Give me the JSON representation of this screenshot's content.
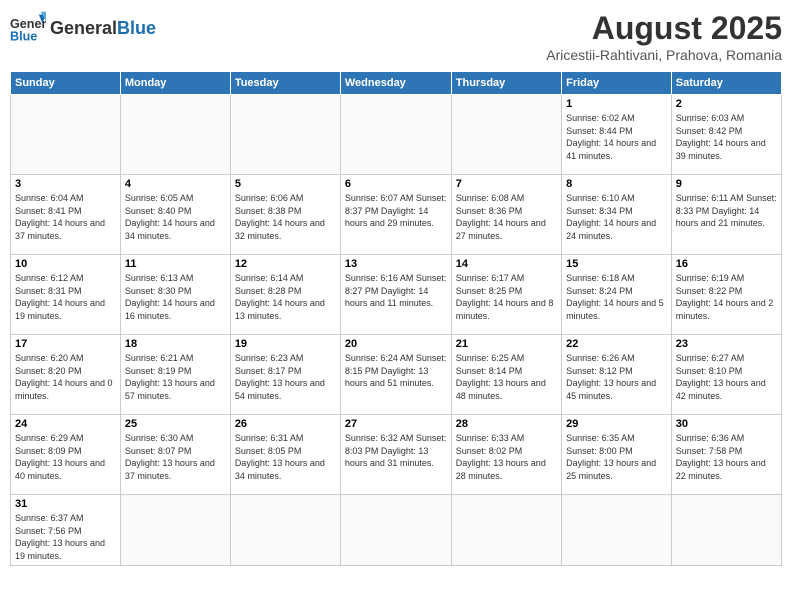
{
  "header": {
    "logo_general": "General",
    "logo_blue": "Blue",
    "month": "August 2025",
    "location": "Aricestii-Rahtivani, Prahova, Romania"
  },
  "days_of_week": [
    "Sunday",
    "Monday",
    "Tuesday",
    "Wednesday",
    "Thursday",
    "Friday",
    "Saturday"
  ],
  "weeks": [
    [
      {
        "day": "",
        "info": ""
      },
      {
        "day": "",
        "info": ""
      },
      {
        "day": "",
        "info": ""
      },
      {
        "day": "",
        "info": ""
      },
      {
        "day": "",
        "info": ""
      },
      {
        "day": "1",
        "info": "Sunrise: 6:02 AM\nSunset: 8:44 PM\nDaylight: 14 hours and 41 minutes."
      },
      {
        "day": "2",
        "info": "Sunrise: 6:03 AM\nSunset: 8:42 PM\nDaylight: 14 hours and 39 minutes."
      }
    ],
    [
      {
        "day": "3",
        "info": "Sunrise: 6:04 AM\nSunset: 8:41 PM\nDaylight: 14 hours and 37 minutes."
      },
      {
        "day": "4",
        "info": "Sunrise: 6:05 AM\nSunset: 8:40 PM\nDaylight: 14 hours and 34 minutes."
      },
      {
        "day": "5",
        "info": "Sunrise: 6:06 AM\nSunset: 8:38 PM\nDaylight: 14 hours and 32 minutes."
      },
      {
        "day": "6",
        "info": "Sunrise: 6:07 AM\nSunset: 8:37 PM\nDaylight: 14 hours and 29 minutes."
      },
      {
        "day": "7",
        "info": "Sunrise: 6:08 AM\nSunset: 8:36 PM\nDaylight: 14 hours and 27 minutes."
      },
      {
        "day": "8",
        "info": "Sunrise: 6:10 AM\nSunset: 8:34 PM\nDaylight: 14 hours and 24 minutes."
      },
      {
        "day": "9",
        "info": "Sunrise: 6:11 AM\nSunset: 8:33 PM\nDaylight: 14 hours and 21 minutes."
      }
    ],
    [
      {
        "day": "10",
        "info": "Sunrise: 6:12 AM\nSunset: 8:31 PM\nDaylight: 14 hours and 19 minutes."
      },
      {
        "day": "11",
        "info": "Sunrise: 6:13 AM\nSunset: 8:30 PM\nDaylight: 14 hours and 16 minutes."
      },
      {
        "day": "12",
        "info": "Sunrise: 6:14 AM\nSunset: 8:28 PM\nDaylight: 14 hours and 13 minutes."
      },
      {
        "day": "13",
        "info": "Sunrise: 6:16 AM\nSunset: 8:27 PM\nDaylight: 14 hours and 11 minutes."
      },
      {
        "day": "14",
        "info": "Sunrise: 6:17 AM\nSunset: 8:25 PM\nDaylight: 14 hours and 8 minutes."
      },
      {
        "day": "15",
        "info": "Sunrise: 6:18 AM\nSunset: 8:24 PM\nDaylight: 14 hours and 5 minutes."
      },
      {
        "day": "16",
        "info": "Sunrise: 6:19 AM\nSunset: 8:22 PM\nDaylight: 14 hours and 2 minutes."
      }
    ],
    [
      {
        "day": "17",
        "info": "Sunrise: 6:20 AM\nSunset: 8:20 PM\nDaylight: 14 hours and 0 minutes."
      },
      {
        "day": "18",
        "info": "Sunrise: 6:21 AM\nSunset: 8:19 PM\nDaylight: 13 hours and 57 minutes."
      },
      {
        "day": "19",
        "info": "Sunrise: 6:23 AM\nSunset: 8:17 PM\nDaylight: 13 hours and 54 minutes."
      },
      {
        "day": "20",
        "info": "Sunrise: 6:24 AM\nSunset: 8:15 PM\nDaylight: 13 hours and 51 minutes."
      },
      {
        "day": "21",
        "info": "Sunrise: 6:25 AM\nSunset: 8:14 PM\nDaylight: 13 hours and 48 minutes."
      },
      {
        "day": "22",
        "info": "Sunrise: 6:26 AM\nSunset: 8:12 PM\nDaylight: 13 hours and 45 minutes."
      },
      {
        "day": "23",
        "info": "Sunrise: 6:27 AM\nSunset: 8:10 PM\nDaylight: 13 hours and 42 minutes."
      }
    ],
    [
      {
        "day": "24",
        "info": "Sunrise: 6:29 AM\nSunset: 8:09 PM\nDaylight: 13 hours and 40 minutes."
      },
      {
        "day": "25",
        "info": "Sunrise: 6:30 AM\nSunset: 8:07 PM\nDaylight: 13 hours and 37 minutes."
      },
      {
        "day": "26",
        "info": "Sunrise: 6:31 AM\nSunset: 8:05 PM\nDaylight: 13 hours and 34 minutes."
      },
      {
        "day": "27",
        "info": "Sunrise: 6:32 AM\nSunset: 8:03 PM\nDaylight: 13 hours and 31 minutes."
      },
      {
        "day": "28",
        "info": "Sunrise: 6:33 AM\nSunset: 8:02 PM\nDaylight: 13 hours and 28 minutes."
      },
      {
        "day": "29",
        "info": "Sunrise: 6:35 AM\nSunset: 8:00 PM\nDaylight: 13 hours and 25 minutes."
      },
      {
        "day": "30",
        "info": "Sunrise: 6:36 AM\nSunset: 7:58 PM\nDaylight: 13 hours and 22 minutes."
      }
    ],
    [
      {
        "day": "31",
        "info": "Sunrise: 6:37 AM\nSunset: 7:56 PM\nDaylight: 13 hours and 19 minutes."
      },
      {
        "day": "",
        "info": ""
      },
      {
        "day": "",
        "info": ""
      },
      {
        "day": "",
        "info": ""
      },
      {
        "day": "",
        "info": ""
      },
      {
        "day": "",
        "info": ""
      },
      {
        "day": "",
        "info": ""
      }
    ]
  ]
}
